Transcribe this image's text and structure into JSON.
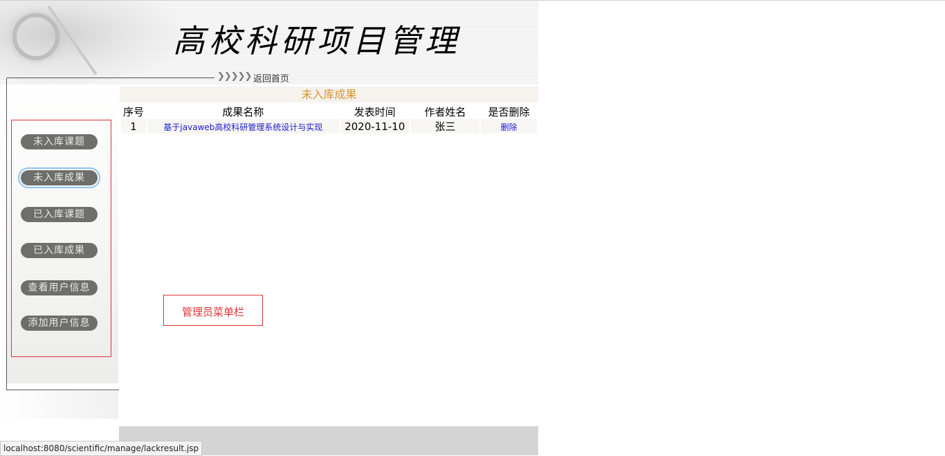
{
  "header": {
    "site_title": "高校科研项目管理",
    "chevrons": "❯❯❯❯❯",
    "home_link": "返回首页"
  },
  "sidebar": {
    "items": [
      {
        "label": "未入库课题",
        "active": false
      },
      {
        "label": "未入库成果",
        "active": true
      },
      {
        "label": "已入库课题",
        "active": false
      },
      {
        "label": "已入库成果",
        "active": false
      },
      {
        "label": "查看用户信息",
        "active": false
      },
      {
        "label": "添加用户信息",
        "active": false
      }
    ]
  },
  "main": {
    "section_title": "未入库成果",
    "columns": [
      "序号",
      "成果名称",
      "发表时间",
      "作者姓名",
      "是否删除"
    ],
    "rows": [
      {
        "index": "1",
        "name": "基于javaweb高校科研管理系统设计与实现",
        "date": "2020-11-10",
        "author": "张三",
        "action": "删除"
      }
    ]
  },
  "annotation": {
    "label": "管理员菜单栏"
  },
  "status_bar": {
    "url": "localhost:8080/scientific/manage/lackresult.jsp"
  },
  "colors": {
    "accent_orange": "#d89530",
    "link_blue": "#1a1ad0",
    "annotation_red": "#dd3333",
    "menu_button_gray": "#6e6e6c"
  }
}
